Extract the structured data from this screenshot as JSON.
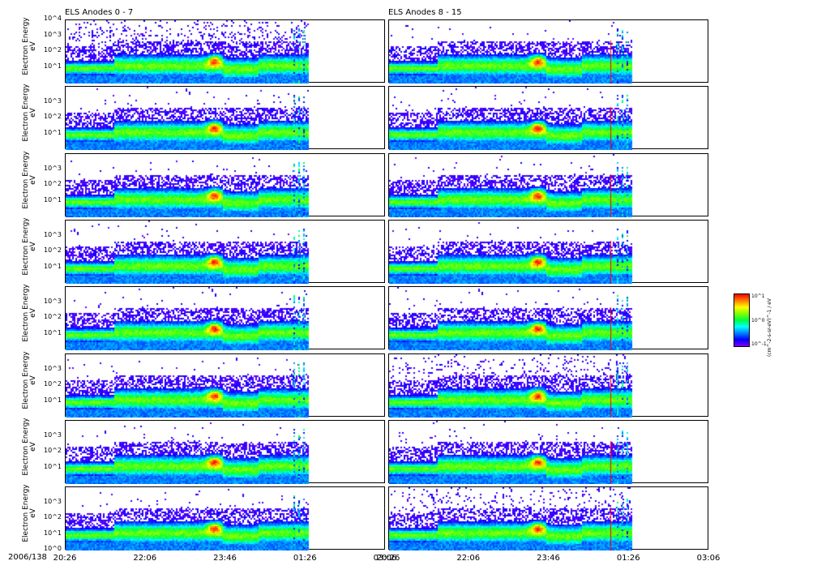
{
  "chart_data": {
    "type": "heatmap",
    "titles": [
      "ELS Anodes 0 - 7",
      "ELS Anodes 8 - 15"
    ],
    "ylabel": "Electron Energy",
    "yunit": "eV",
    "yscale": "log",
    "ylim": [
      1,
      10000
    ],
    "ytick_labels": [
      "10^0",
      "10^1",
      "10^2",
      "10^3",
      "10^4"
    ],
    "xlabel_prefix": "2006/138",
    "xtick_labels": [
      "20:26",
      "22:06",
      "23:46",
      "01:26",
      "03:06"
    ],
    "xlim_minutes": [
      0,
      400
    ],
    "data_end_minutes": 302,
    "columns": [
      {
        "title": "ELS Anodes 0 - 7",
        "anodes": [
          0,
          1,
          2,
          3,
          4,
          5,
          6,
          7
        ]
      },
      {
        "title": "ELS Anodes 8 - 15",
        "anodes": [
          8,
          9,
          10,
          11,
          12,
          13,
          14,
          15
        ]
      }
    ],
    "features": {
      "core_band_energy_eV": 10,
      "band_widening_time": "21:25",
      "peak_flux_time": "23:30",
      "peak_flux_energy_eV": 40
    },
    "colorbar": {
      "label": "(cm^-2-s-sr-eV)^-1 / eV",
      "tick_labels": [
        "10^-1",
        "10^0",
        "10^1"
      ],
      "colormap": [
        "#8000ff",
        "#0000ff",
        "#0080ff",
        "#00ffff",
        "#00ff40",
        "#80ff00",
        "#ffff00",
        "#ff8000",
        "#ff0000"
      ]
    }
  }
}
